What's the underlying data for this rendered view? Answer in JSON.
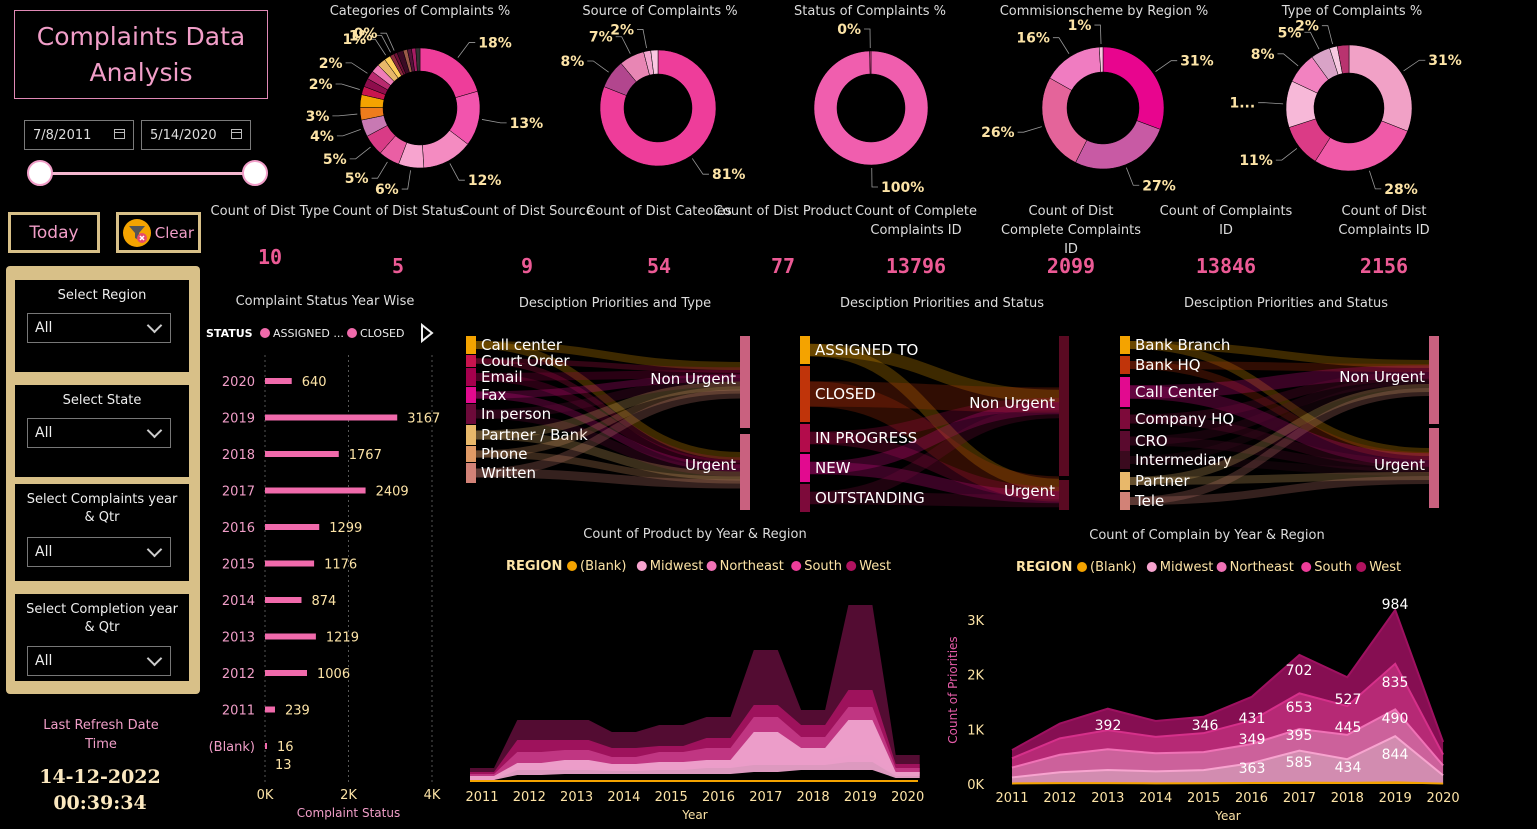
{
  "header": {
    "title": "Complaints Data Analysis"
  },
  "date_range": {
    "start": "7/8/2011",
    "end": "5/14/2020"
  },
  "buttons": {
    "today": "Today",
    "clear": "Clear"
  },
  "slicers": [
    {
      "label": "Select Region",
      "value": "All"
    },
    {
      "label": "Select State",
      "value": "All"
    },
    {
      "label": "Select Complaints year & Qtr",
      "value": "All"
    },
    {
      "label": "Select Completion year & Qtr",
      "value": "All"
    }
  ],
  "refresh": {
    "label": "Last Refresh Date Time",
    "date": "14-12-2022",
    "time": "00:39:34"
  },
  "colors": {
    "pink": "#ec5a95",
    "gold": "#d8c088",
    "orange": "#f4a300"
  },
  "cards": [
    {
      "label": "Count of Dist Type",
      "value": "10"
    },
    {
      "label": "Count of Dist Status",
      "value": "5"
    },
    {
      "label": "Count of Dist Source",
      "value": "9"
    },
    {
      "label": "Count of Dist Cateoies",
      "value": "54"
    },
    {
      "label": "Count of Dist Product",
      "value": "77"
    },
    {
      "label": "Count of Complete Complaints ID",
      "value": "13796"
    },
    {
      "label": "Count of Dist Complete Complaints ID",
      "value": "2099"
    },
    {
      "label": "Count of Complaints ID",
      "value": "13846"
    },
    {
      "label": "Count of Dist Complaints ID",
      "value": "2156"
    }
  ],
  "chart_data": [
    {
      "type": "pie",
      "title": "Categories of Complaints %",
      "slices": [
        {
          "label": "18%",
          "value": 18,
          "color": "#ee3d9a"
        },
        {
          "label": "13%",
          "value": 13,
          "color": "#f254ad"
        },
        {
          "label": "12%",
          "value": 12,
          "color": "#f48bc1"
        },
        {
          "label": "6%",
          "value": 6,
          "color": "#f7a4cf"
        },
        {
          "label": "5%",
          "value": 5,
          "color": "#ea5fa4"
        },
        {
          "label": "5%",
          "value": 5,
          "color": "#d93b86"
        },
        {
          "label": "4%",
          "value": 4,
          "color": "#c879b3"
        },
        {
          "label": "3%",
          "value": 3,
          "color": "#ee7c1c"
        },
        {
          "label": "",
          "value": 3,
          "color": "#f4a300"
        },
        {
          "label": "2%",
          "value": 2,
          "color": "#c9144e"
        },
        {
          "label": "",
          "value": 2,
          "color": "#8e0d4c"
        },
        {
          "label": "2%",
          "value": 2,
          "color": "#b92a6e"
        },
        {
          "label": "",
          "value": 2,
          "color": "#f07db8"
        },
        {
          "label": "",
          "value": 2,
          "color": "#e8b86a"
        },
        {
          "label": "1%",
          "value": 1.5,
          "color": "#ffcf5a"
        },
        {
          "label": "1%",
          "value": 1,
          "color": "#8a2a3d"
        },
        {
          "label": "0%",
          "value": 0.8,
          "color": "#6e0f36"
        },
        {
          "label": "",
          "value": 1.5,
          "color": "#3a0a24"
        },
        {
          "label": "",
          "value": 1,
          "color": "#9c5b48"
        },
        {
          "label": "",
          "value": 1,
          "color": "#54133a"
        },
        {
          "label": "",
          "value": 1,
          "color": "#a51c63"
        },
        {
          "label": "",
          "value": 1,
          "color": "#333"
        }
      ]
    },
    {
      "type": "pie",
      "title": "Source of Complaints %",
      "slices": [
        {
          "label": "81%",
          "value": 81,
          "color": "#ee3d9a"
        },
        {
          "label": "8%",
          "value": 8,
          "color": "#b2468e"
        },
        {
          "label": "7%",
          "value": 7,
          "color": "#e886b4"
        },
        {
          "label": "2%",
          "value": 2,
          "color": "#f4a6cf"
        },
        {
          "label": "",
          "value": 2,
          "color": "#fbc8e3"
        }
      ]
    },
    {
      "type": "pie",
      "title": "Status of Complaints %",
      "slices": [
        {
          "label": "100%",
          "value": 99.6,
          "color": "#f05eae"
        },
        {
          "label": "0%",
          "value": 0.4,
          "color": "#c33a7e"
        }
      ]
    },
    {
      "type": "pie",
      "title": "Commisionscheme by Region %",
      "slices": [
        {
          "label": "31%",
          "value": 31,
          "color": "#e8058e"
        },
        {
          "label": "27%",
          "value": 27,
          "color": "#c85aa4"
        },
        {
          "label": "26%",
          "value": 26,
          "color": "#e4649a"
        },
        {
          "label": "16%",
          "value": 16,
          "color": "#f07cc1"
        },
        {
          "label": "1%",
          "value": 1,
          "color": "#f9c6e0"
        }
      ]
    },
    {
      "type": "pie",
      "title": "Type of Complaints %",
      "slices": [
        {
          "label": "31%",
          "value": 31,
          "color": "#f1a1c6"
        },
        {
          "label": "28%",
          "value": 28,
          "color": "#f05aa8"
        },
        {
          "label": "11%",
          "value": 11,
          "color": "#db3b86"
        },
        {
          "label": "1...",
          "value": 12,
          "color": "#f7b8d8"
        },
        {
          "label": "8%",
          "value": 8,
          "color": "#f282c0"
        },
        {
          "label": "5%",
          "value": 5,
          "color": "#d9a3c7"
        },
        {
          "label": "2%",
          "value": 2,
          "color": "#f7c9e0"
        },
        {
          "label": "",
          "value": 3,
          "color": "#b9336f"
        }
      ]
    },
    {
      "type": "bar",
      "title": "Complaint Status Year Wise",
      "legend_title": "STATUS",
      "legend": [
        "ASSIGNED ...",
        "CLOSED"
      ],
      "categories": [
        "2020",
        "2019",
        "2018",
        "2017",
        "2016",
        "2015",
        "2014",
        "2013",
        "2012",
        "2011",
        "(Blank)"
      ],
      "values": [
        640,
        3167,
        1767,
        2409,
        1299,
        1176,
        874,
        1219,
        1006,
        239,
        16
      ],
      "blank_extra": 13,
      "xlabel": "Complaint Status",
      "xticks": [
        "0K",
        "2K",
        "4K"
      ],
      "xlim": [
        0,
        4000
      ]
    },
    {
      "type": "area",
      "title": "Count of Product by Year & Region",
      "legend_title": "REGION",
      "legend": [
        "(Blank)",
        "Midwest",
        "Northeast",
        "South",
        "West"
      ],
      "legend_colors": [
        "#f4a300",
        "#f7a4cf",
        "#f072b6",
        "#ee3d9a",
        "#b0125f"
      ],
      "categories": [
        "2011",
        "2012",
        "2013",
        "2014",
        "2015",
        "2016",
        "2017",
        "2018",
        "2019",
        "2020"
      ],
      "xlabel": "Year"
    },
    {
      "type": "area",
      "title": "Count of Complain by Year & Region",
      "legend_title": "REGION",
      "legend": [
        "(Blank)",
        "Midwest",
        "Northeast",
        "South",
        "West"
      ],
      "legend_colors": [
        "#f4a300",
        "#f7a4cf",
        "#f072b6",
        "#ee3d9a",
        "#b0125f"
      ],
      "categories": [
        "2011",
        "2012",
        "2013",
        "2014",
        "2015",
        "2016",
        "2017",
        "2018",
        "2019",
        "2020"
      ],
      "series": [
        {
          "name": "(Blank)",
          "values": [
            10,
            15,
            15,
            12,
            14,
            18,
            25,
            20,
            30,
            8
          ]
        },
        {
          "name": "Midwest",
          "values": [
            110,
            200,
            240,
            220,
            240,
            363,
            585,
            434,
            844,
            150
          ]
        },
        {
          "name": "Northeast",
          "values": [
            180,
            320,
            380,
            330,
            330,
            349,
            395,
            445,
            490,
            180
          ]
        },
        {
          "name": "South",
          "values": [
            170,
            300,
            350,
            300,
            346,
            431,
            653,
            527,
            835,
            200
          ]
        },
        {
          "name": "West",
          "values": [
            150,
            270,
            392,
            290,
            300,
            431,
            702,
            527,
            984,
            230
          ]
        }
      ],
      "point_labels": [
        "392",
        "346",
        "431",
        "349",
        "363",
        "702",
        "653",
        "395",
        "585",
        "527",
        "445",
        "434",
        "984",
        "835",
        "490",
        "844"
      ],
      "ylabel": "Count of Priorities",
      "xlabel": "Year",
      "yticks": [
        "0K",
        "1K",
        "2K",
        "3K"
      ],
      "ylim": [
        0,
        3000
      ]
    }
  ],
  "sankeys": [
    {
      "title": "Desciption Priorities and Type",
      "left": [
        "Call center",
        "Court Order",
        "Email",
        "Fax",
        "In person",
        "Partner / Bank",
        "Phone",
        "Written"
      ],
      "right": [
        "Non Urgent",
        "Urgent"
      ]
    },
    {
      "title": "Desciption Priorities and Status",
      "left": [
        "ASSIGNED TO",
        "CLOSED",
        "IN PROGRESS",
        "NEW",
        "OUTSTANDING"
      ],
      "right": [
        "Non Urgent",
        "Urgent"
      ]
    },
    {
      "title": "Desciption Priorities and Status",
      "left": [
        "Bank Branch",
        "Bank HQ",
        "Call Center",
        "Company HQ",
        "CRO",
        "Intermediary",
        "Partner",
        "Tele"
      ],
      "right": [
        "Non Urgent",
        "Urgent"
      ]
    }
  ]
}
